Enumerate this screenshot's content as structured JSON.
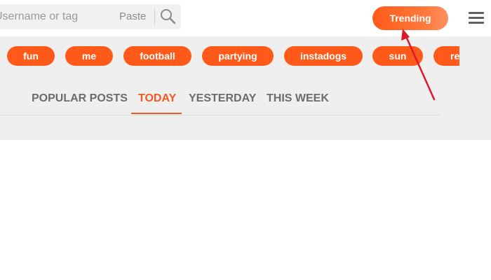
{
  "search": {
    "placeholder": "Username or tag",
    "paste_label": "Paste",
    "search_icon": "magnifier-icon"
  },
  "header": {
    "trending_label": "Trending",
    "menu_icon": "hamburger-menu-icon"
  },
  "tags": [
    "fun",
    "me",
    "football",
    "partying",
    "instadogs",
    "sun",
    "re"
  ],
  "tabs": [
    {
      "label": "POPULAR POSTS",
      "active": false
    },
    {
      "label": "TODAY",
      "active": true
    },
    {
      "label": "YESTERDAY",
      "active": false
    },
    {
      "label": "THIS WEEK",
      "active": false
    }
  ],
  "colors": {
    "accent": "#ff5a1a",
    "active_tab": "#f05a22",
    "annotation_arrow": "#e0162b",
    "panel_background": "#efefef"
  }
}
